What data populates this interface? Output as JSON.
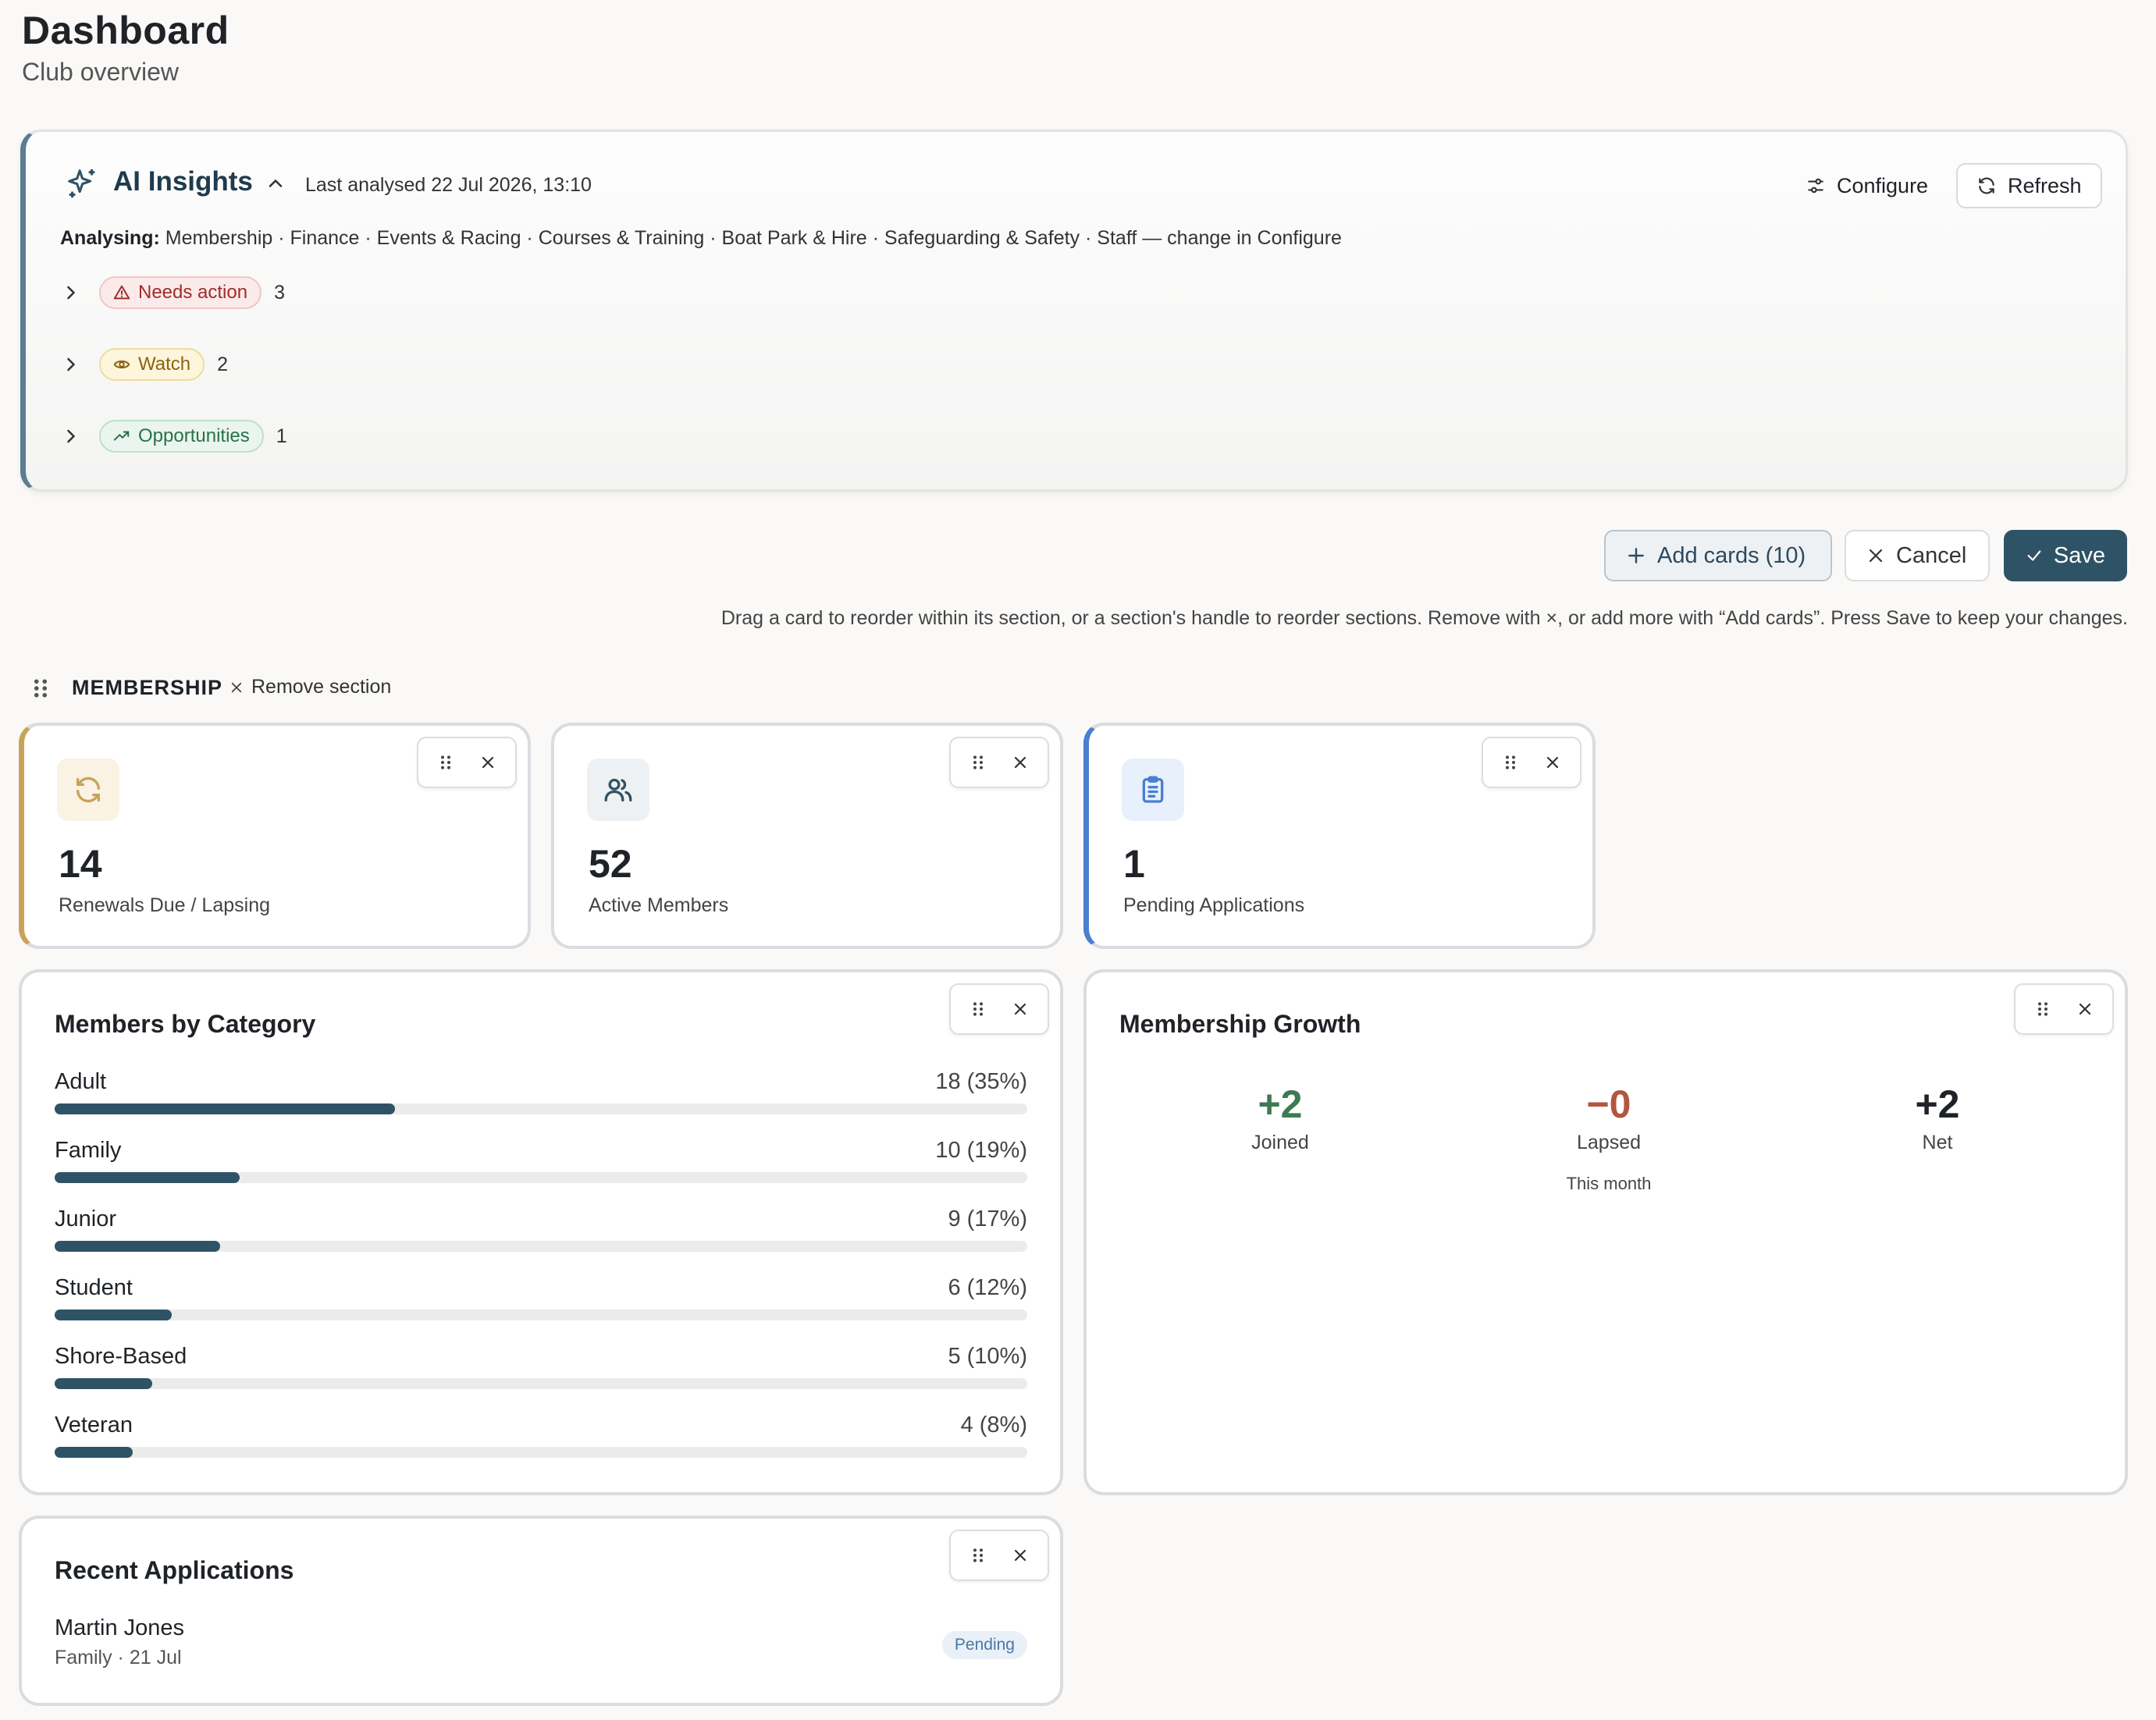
{
  "header": {
    "title": "Dashboard",
    "subtitle": "Club overview"
  },
  "ai_insights": {
    "title": "AI Insights",
    "last_analysed": "Last analysed 22 Jul 2026, 13:10",
    "configure_label": "Configure",
    "refresh_label": "Refresh",
    "analysing_label": "Analysing:",
    "analysing_text": "Membership · Finance · Events & Racing · Courses & Training · Boat Park & Hire · Safeguarding & Safety · Staff — change in Configure",
    "groups": [
      {
        "label": "Needs action",
        "count": "3",
        "color": "#a22b2b"
      },
      {
        "label": "Watch",
        "count": "2",
        "color": "#8a6410"
      },
      {
        "label": "Opportunities",
        "count": "1",
        "color": "#2a7148"
      }
    ]
  },
  "actions": {
    "add_cards_label": "Add cards (10)",
    "cancel_label": "Cancel",
    "save_label": "Save",
    "hint": "Drag a card to reorder within its section, or a section's handle to reorder sections. Remove with ×, or add more with “Add cards”. Press Save to keep your changes."
  },
  "section": {
    "title": "MEMBERSHIP",
    "remove_label": "Remove section"
  },
  "stats": [
    {
      "value": "14",
      "label": "Renewals Due / Lapsing",
      "icon": "refresh-icon",
      "accent": "#c9a25a"
    },
    {
      "value": "52",
      "label": "Active Members",
      "icon": "users-icon",
      "accent": "#dadcdf"
    },
    {
      "value": "1",
      "label": "Pending Applications",
      "icon": "clipboard-icon",
      "accent": "#4a7fd0"
    }
  ],
  "members_by_category": {
    "title": "Members by Category",
    "rows": [
      {
        "name": "Adult",
        "value": "18 (35%)",
        "percent": 35
      },
      {
        "name": "Family",
        "value": "10 (19%)",
        "percent": 19
      },
      {
        "name": "Junior",
        "value": "9 (17%)",
        "percent": 17
      },
      {
        "name": "Student",
        "value": "6 (12%)",
        "percent": 12
      },
      {
        "name": "Shore-Based",
        "value": "5 (10%)",
        "percent": 10
      },
      {
        "name": "Veteran",
        "value": "4 (8%)",
        "percent": 8
      }
    ]
  },
  "membership_growth": {
    "title": "Membership Growth",
    "joined": {
      "value": "+2",
      "label": "Joined",
      "color": "#3d7a52"
    },
    "lapsed": {
      "value": "−0",
      "label": "Lapsed",
      "color": "#b4553f",
      "sub": "This month"
    },
    "net": {
      "value": "+2",
      "label": "Net",
      "color": "#1f2328"
    }
  },
  "recent_applications": {
    "title": "Recent Applications",
    "items": [
      {
        "name": "Martin Jones",
        "meta": "Family · 21 Jul",
        "status": "Pending"
      }
    ]
  }
}
